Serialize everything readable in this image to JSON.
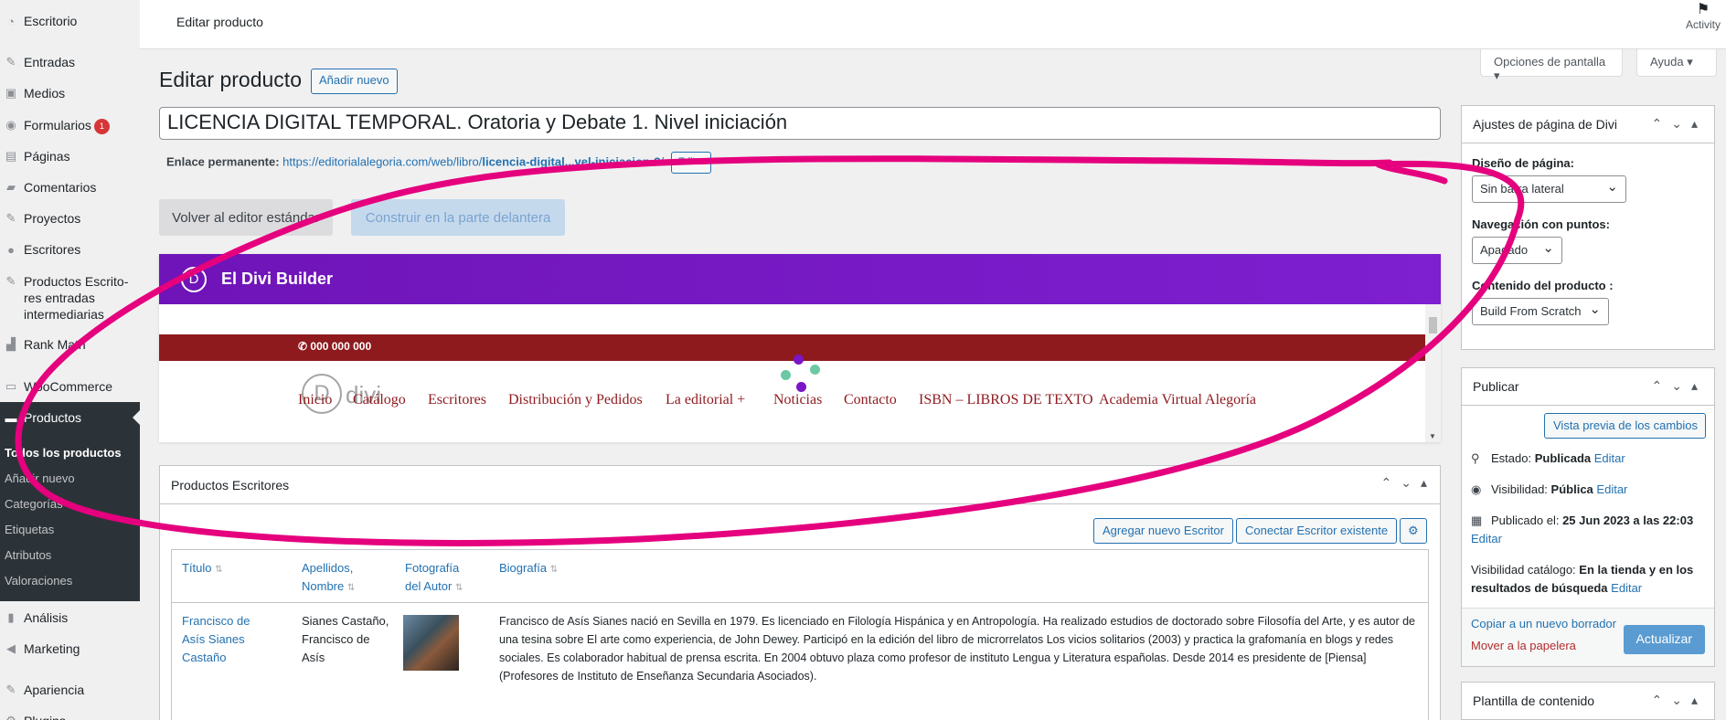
{
  "sidebar": {
    "items": [
      {
        "label": "Escritorio",
        "icon": "dashboard-icon"
      },
      {
        "label": "Entradas",
        "icon": "pin-icon"
      },
      {
        "label": "Medios",
        "icon": "media-icon"
      },
      {
        "label": "Formularios",
        "icon": "forms-icon",
        "badge": "1"
      },
      {
        "label": "Páginas",
        "icon": "pages-icon"
      },
      {
        "label": "Comentarios",
        "icon": "comment-icon"
      },
      {
        "label": "Proyectos",
        "icon": "pin-icon"
      },
      {
        "label": "Escritores",
        "icon": "user-icon"
      },
      {
        "label": "Productos Escrito-res entradas intermediarias",
        "icon": "pin-icon"
      },
      {
        "label": "Rank Math",
        "icon": "rank-math-icon"
      },
      {
        "label": "WooCommerce",
        "icon": "woocommerce-icon"
      },
      {
        "label": "Productos",
        "icon": "products-icon"
      },
      {
        "label": "Análisis",
        "icon": "bar-chart-icon"
      },
      {
        "label": "Marketing",
        "icon": "megaphone-icon"
      },
      {
        "label": "Apariencia",
        "icon": "brush-icon"
      },
      {
        "label": "Plugins",
        "icon": "plugin-icon"
      }
    ],
    "submenu": [
      "Todos los productos",
      "Añadir nuevo",
      "Categorías",
      "Etiquetas",
      "Atributos",
      "Valoraciones"
    ]
  },
  "topbar": {
    "title": "Editar producto",
    "activity": "Activity"
  },
  "screen_options": {
    "options": "Opciones de pantalla ▾",
    "help": "Ayuda ▾"
  },
  "main": {
    "heading": "Editar producto",
    "add_new": "Añadir nuevo",
    "product_title": "LICENCIA DIGITAL TEMPORAL. Oratoria y Debate 1. Nivel iniciación",
    "permalink_label": "Enlace permanente:",
    "permalink_base": "https://editorialalegoria.com/web/libro/",
    "permalink_slug": "licencia-digital...vel-iniciacion-2",
    "permalink_end": "/",
    "edit_slug": "Editar",
    "btn_standard_editor": "Volver al editor estándar",
    "btn_front_builder": "Construir en la parte delantera"
  },
  "divi": {
    "logo": "D",
    "title": "El Divi Builder",
    "phone": "✆ 000 000 000",
    "watermark": "D",
    "watermark_text": "divi",
    "nav": [
      "Inicio",
      "Catálogo",
      "Escritores",
      "Distribución y Pedidos",
      "La editorial  +",
      "Noticias",
      "Contacto",
      "ISBN – LIBROS DE TEXTO",
      "Academia Virtual Alegoría"
    ]
  },
  "productos_escritores": {
    "title": "Productos Escritores",
    "btn_add": "Agregar nuevo Escritor",
    "btn_connect": "Conectar Escritor existente",
    "columns": [
      "Título",
      "Apellidos, Nombre",
      "Fotografía del Autor",
      "Biografía"
    ],
    "rows": [
      {
        "titulo": "Francisco de Asís Sianes Castaño",
        "apellidos": "Sianes Castaño, Francisco de Asís",
        "biografia": "Francisco de Asís Sianes nació en Sevilla en 1979. Es licenciado en Filología Hispánica y en Antropología. Ha realizado estudios de doctorado sobre Filosofía del Arte, y es autor de una tesina sobre El arte como experiencia, de John Dewey. Participó en la edición del libro de microrrelatos Los vicios solitarios (2003) y practica la grafomanía en blogs y redes sociales. Es colaborador habitual de prensa escrita. En 2004 obtuvo plaza como profesor de instituto Lengua y Literatura españolas. Desde 2014 es presidente de [Piensa] (Profesores de Instituto de Enseñanza Secundaria Asociados)."
      }
    ]
  },
  "divi_settings": {
    "title": "Ajustes de página de Divi",
    "layout_label": "Diseño de página:",
    "layout_value": "Sin barra lateral",
    "dots_label": "Navegación con puntos:",
    "dots_value": "Apagado",
    "content_label": "Contenido del producto :",
    "content_value": "Build From Scratch"
  },
  "publish": {
    "title": "Publicar",
    "preview": "Vista previa de los cambios",
    "status_label": "Estado:",
    "status_value": "Publicada",
    "visibility_label": "Visibilidad:",
    "visibility_value": "Pública",
    "published_label": "Publicado el:",
    "published_value": "25 Jun 2023 a las 22:03",
    "edit": "Editar",
    "catalog_label": "Visibilidad catálogo:",
    "catalog_value": "En la tienda y en los resultados de búsqueda",
    "copy_draft": "Copiar a un nuevo borrador",
    "trash": "Mover a la papelera",
    "update": "Actualizar"
  },
  "content_template": {
    "title": "Plantilla de contenido"
  },
  "colors": {
    "accent": "#2271b1",
    "divi_purple": "#7b16c7",
    "site_red": "#8e1a1e",
    "marker": "#e5007e"
  }
}
